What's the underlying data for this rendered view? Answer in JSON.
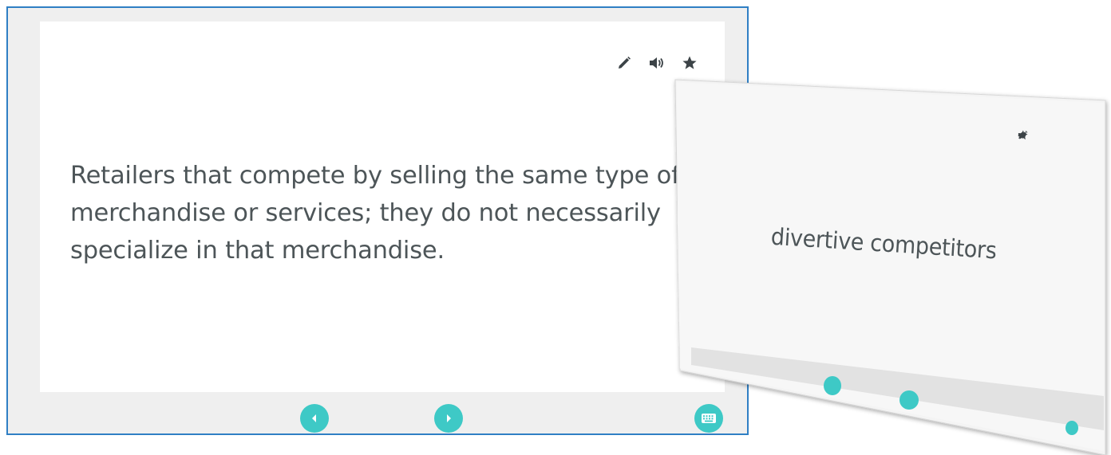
{
  "front_card": {
    "definition": "Retailers that compete by selling the same type of merchandise or services; they do not necessarily specialize in that merchandise.",
    "icons": [
      "edit-icon",
      "audio-icon",
      "star-icon"
    ],
    "nav": {
      "prev_icon": "chevron-left-icon",
      "next_icon": "chevron-right-icon",
      "keyboard_icon": "keyboard-icon"
    }
  },
  "back_card": {
    "term": "divertive competitors",
    "icons": [
      "edit-icon",
      "audio-icon",
      "star-icon"
    ]
  },
  "colors": {
    "accent": "#3ec9c6",
    "frame_border": "#2f7fc4",
    "text": "#4d5558",
    "icon": "#3c4347",
    "frame_background": "#efefef"
  }
}
